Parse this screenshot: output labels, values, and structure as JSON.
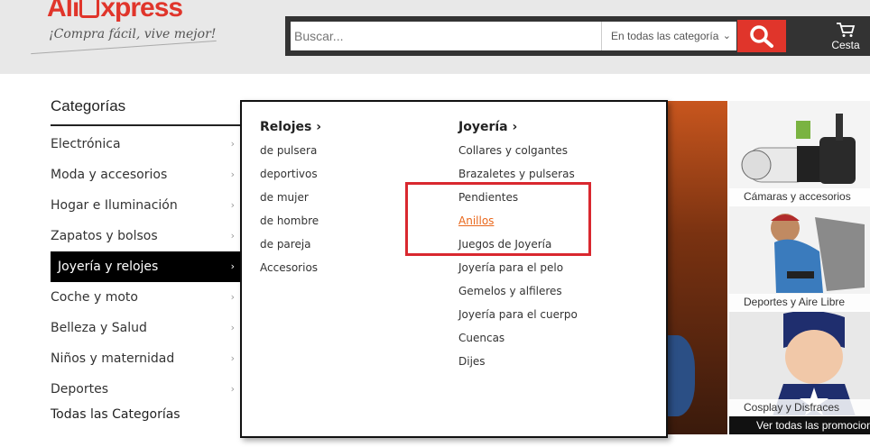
{
  "header": {
    "logo_part1": "Ali",
    "logo_part2": "xpress",
    "slogan": "¡Compra fácil, vive mejor!",
    "search_placeholder": "Buscar...",
    "category_select": "En todas las categoría",
    "cart_label": "Cesta"
  },
  "sidebar": {
    "title": "Categorías",
    "items": [
      {
        "label": "Electrónica"
      },
      {
        "label": "Moda y accesorios"
      },
      {
        "label": "Hogar e Iluminación"
      },
      {
        "label": "Zapatos y bolsos"
      },
      {
        "label": "Joyería y relojes"
      },
      {
        "label": "Coche y moto"
      },
      {
        "label": "Belleza y Salud"
      },
      {
        "label": "Niños y maternidad"
      },
      {
        "label": "Deportes"
      }
    ],
    "arrow": "›",
    "all_label": "Todas las Categorías"
  },
  "flyout": {
    "col1": {
      "title": "Relojes",
      "chevron": "›",
      "links": [
        "de pulsera",
        "deportivos",
        "de mujer",
        "de hombre",
        "de pareja",
        "Accesorios"
      ]
    },
    "col2": {
      "title": "Joyería",
      "chevron": "›",
      "links": [
        "Collares y colgantes",
        "Brazaletes y pulseras",
        "Pendientes",
        "Anillos",
        "Juegos de Joyería",
        "Joyería para el pelo",
        "Gemelos y alfileres",
        "Joyería para el cuerpo",
        "Cuencas",
        "Dijes"
      ]
    }
  },
  "tiles": [
    {
      "caption": "Cámaras y accesorios"
    },
    {
      "caption": "Deportes y Aire Libre"
    },
    {
      "caption": "Cosplay y Disfraces"
    }
  ],
  "see_all": "Ver todas las promociones",
  "colors": {
    "brand": "#e0352b",
    "hover_link": "#e9671b",
    "highlight": "#d9282f"
  }
}
